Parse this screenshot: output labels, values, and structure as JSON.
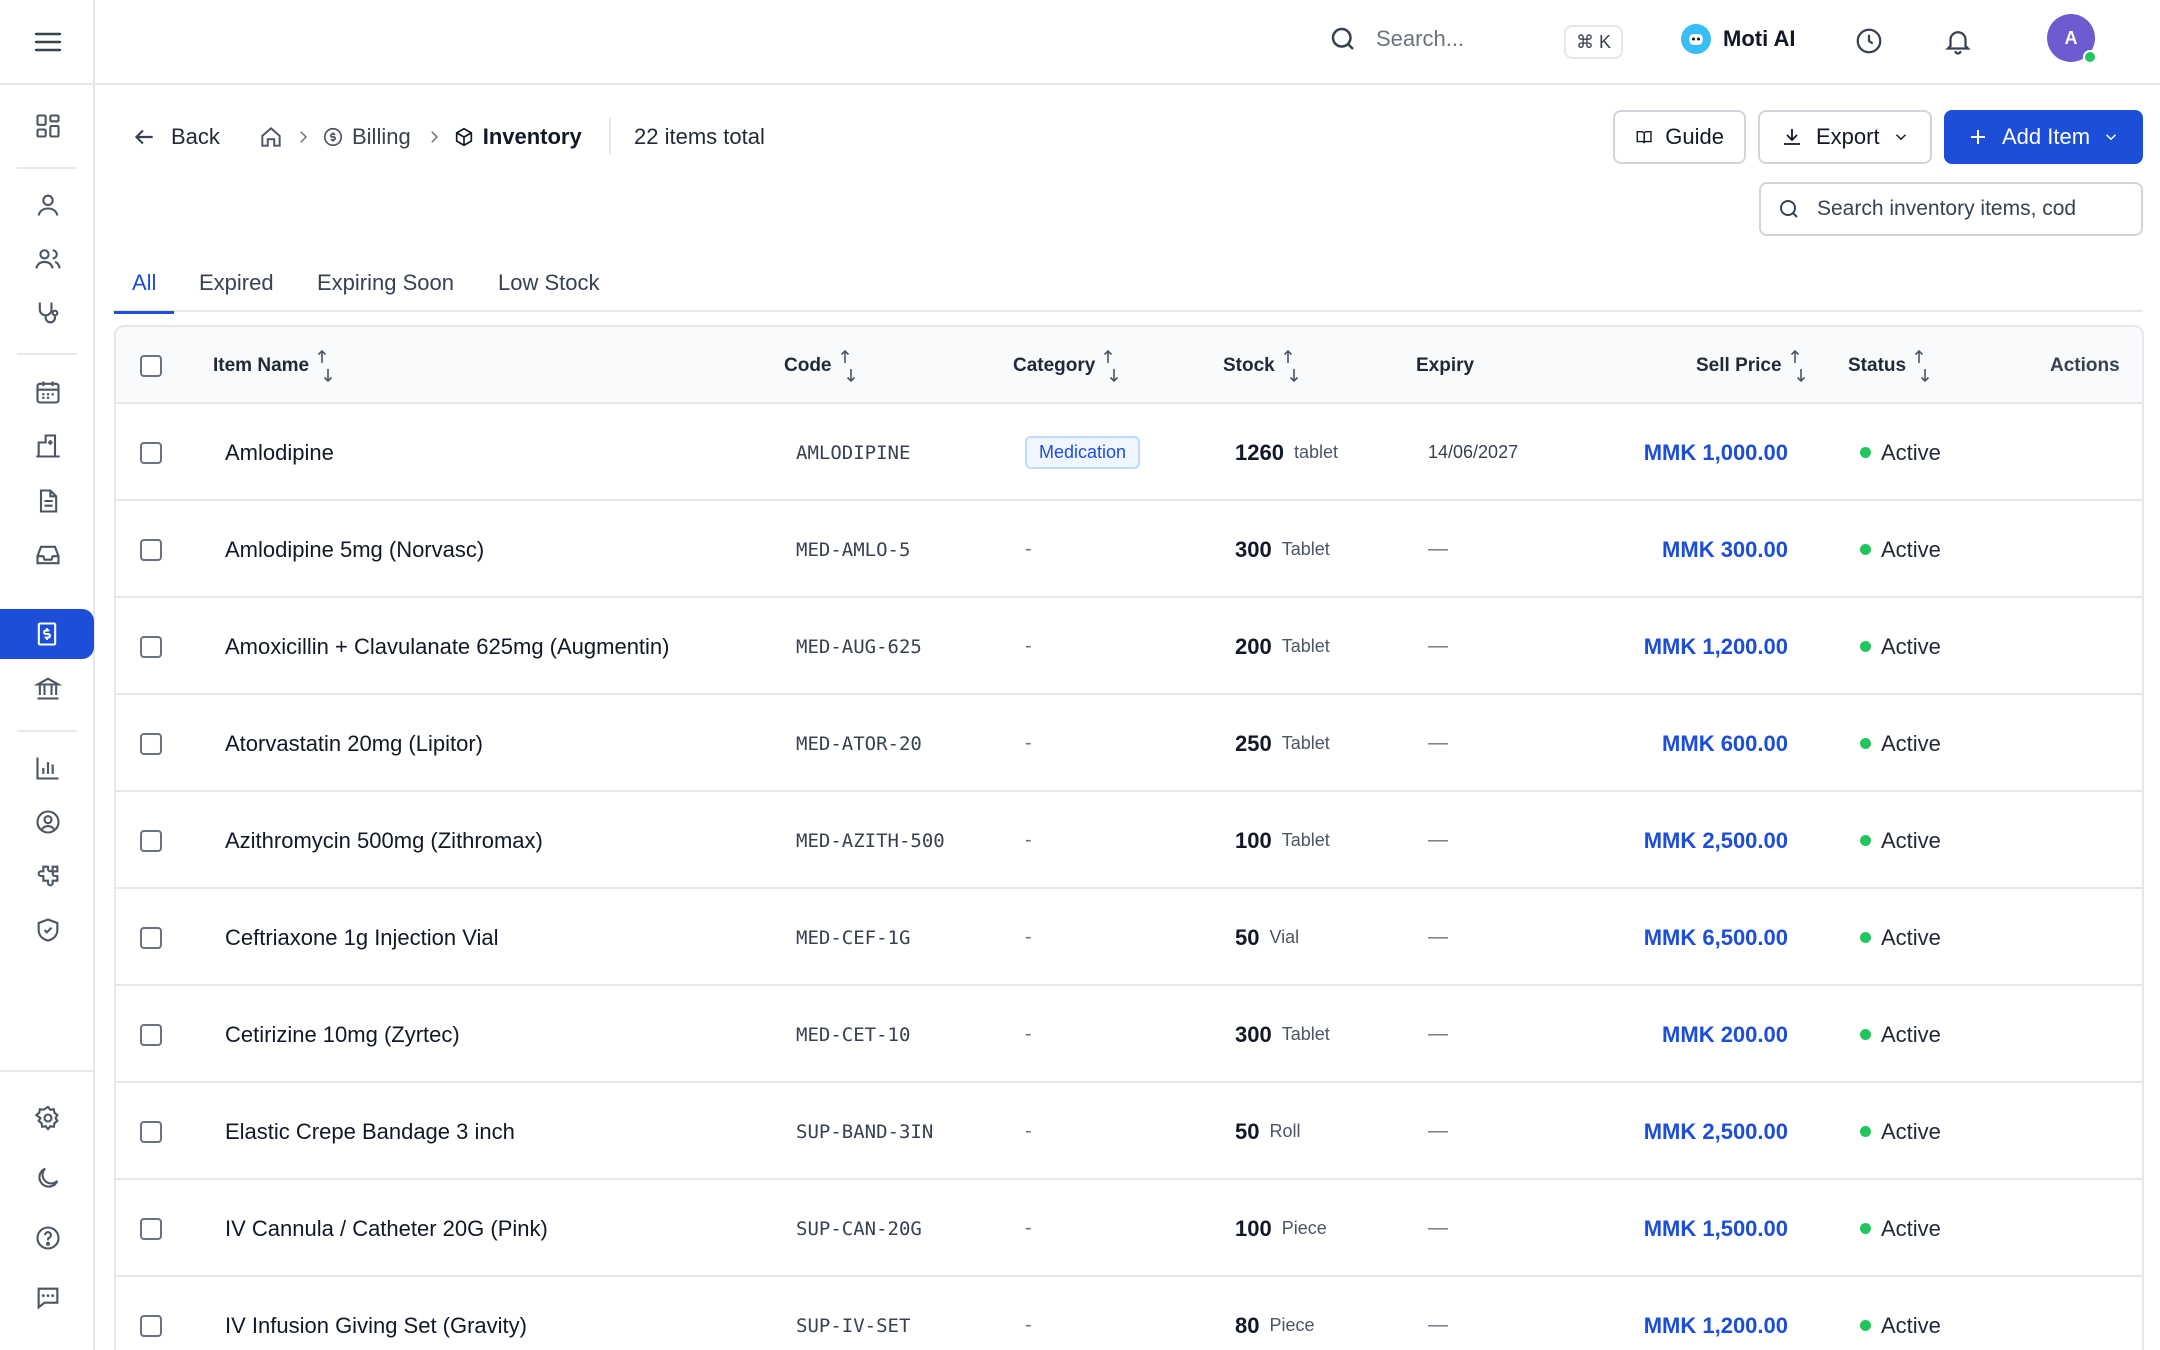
{
  "topbar": {
    "search_placeholder": "Search...",
    "shortcut": "⌘ K",
    "ai_label": "Moti AI",
    "avatar_initial": "A"
  },
  "header": {
    "back_label": "Back",
    "breadcrumb": [
      "Billing",
      "Inventory"
    ],
    "items_total": "22 items total",
    "guide_label": "Guide",
    "export_label": "Export",
    "add_item_label": "Add Item",
    "search_placeholder": "Search inventory items, cod"
  },
  "tabs": [
    "All",
    "Expired",
    "Expiring Soon",
    "Low Stock"
  ],
  "table": {
    "columns": [
      "Item Name",
      "Code",
      "Category",
      "Stock",
      "Expiry",
      "Sell Price",
      "Status",
      "Actions"
    ],
    "rows": [
      {
        "name": "Amlodipine",
        "code": "AMLODIPINE",
        "category": "Medication",
        "stock": "1260",
        "unit": "tablet",
        "expiry": "14/06/2027",
        "price": "MMK 1,000.00",
        "status": "Active"
      },
      {
        "name": "Amlodipine 5mg (Norvasc)",
        "code": "MED-AMLO-5",
        "category": "-",
        "stock": "300",
        "unit": "Tablet",
        "expiry": "—",
        "price": "MMK 300.00",
        "status": "Active"
      },
      {
        "name": "Amoxicillin + Clavulanate 625mg (Augmentin)",
        "code": "MED-AUG-625",
        "category": "-",
        "stock": "200",
        "unit": "Tablet",
        "expiry": "—",
        "price": "MMK 1,200.00",
        "status": "Active"
      },
      {
        "name": "Atorvastatin 20mg (Lipitor)",
        "code": "MED-ATOR-20",
        "category": "-",
        "stock": "250",
        "unit": "Tablet",
        "expiry": "—",
        "price": "MMK 600.00",
        "status": "Active"
      },
      {
        "name": "Azithromycin 500mg (Zithromax)",
        "code": "MED-AZITH-500",
        "category": "-",
        "stock": "100",
        "unit": "Tablet",
        "expiry": "—",
        "price": "MMK 2,500.00",
        "status": "Active"
      },
      {
        "name": "Ceftriaxone 1g Injection Vial",
        "code": "MED-CEF-1G",
        "category": "-",
        "stock": "50",
        "unit": "Vial",
        "expiry": "—",
        "price": "MMK 6,500.00",
        "status": "Active"
      },
      {
        "name": "Cetirizine 10mg (Zyrtec)",
        "code": "MED-CET-10",
        "category": "-",
        "stock": "300",
        "unit": "Tablet",
        "expiry": "—",
        "price": "MMK 200.00",
        "status": "Active"
      },
      {
        "name": "Elastic Crepe Bandage 3 inch",
        "code": "SUP-BAND-3IN",
        "category": "-",
        "stock": "50",
        "unit": "Roll",
        "expiry": "—",
        "price": "MMK 2,500.00",
        "status": "Active"
      },
      {
        "name": "IV Cannula / Catheter 20G (Pink)",
        "code": "SUP-CAN-20G",
        "category": "-",
        "stock": "100",
        "unit": "Piece",
        "expiry": "—",
        "price": "MMK 1,500.00",
        "status": "Active"
      },
      {
        "name": "IV Infusion Giving Set (Gravity)",
        "code": "SUP-IV-SET",
        "category": "-",
        "stock": "80",
        "unit": "Piece",
        "expiry": "—",
        "price": "MMK 1,200.00",
        "status": "Active"
      }
    ]
  }
}
